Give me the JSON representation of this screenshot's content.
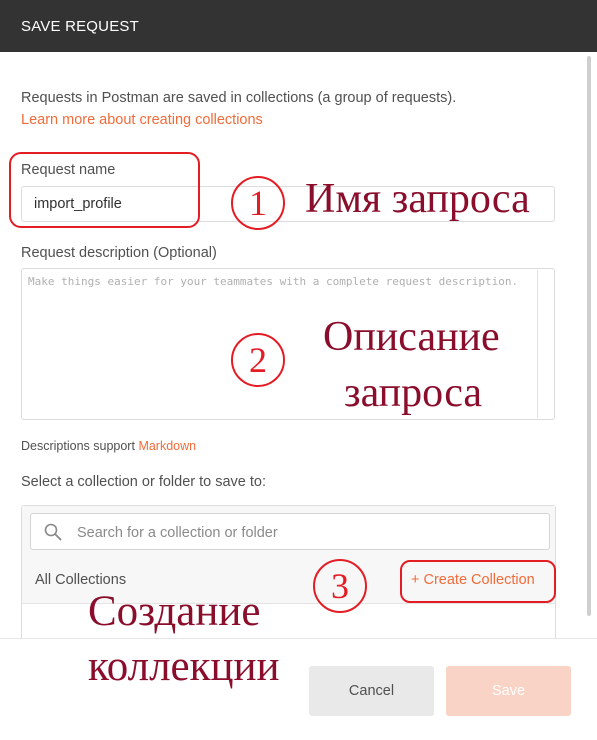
{
  "dialog": {
    "title": "SAVE REQUEST",
    "intro_text": "Requests in Postman are saved in collections (a group of requests).",
    "learn_more_link": "Learn more about creating collections",
    "request_name_label": "Request name",
    "request_name_value": "import_profile",
    "request_description_label": "Request description (Optional)",
    "request_description_placeholder": "Make things easier for your teammates with a complete request description.",
    "descriptions_support_text": "Descriptions support",
    "markdown_link": "Markdown",
    "select_collection_label": "Select a collection or folder to save to:",
    "search_placeholder": "Search for a collection or folder",
    "all_collections_label": "All Collections",
    "create_collection_link": "+ Create Collection",
    "cancel_button": "Cancel",
    "save_button": "Save"
  },
  "annotations": {
    "step1_number": "1",
    "step1_text": "Имя запроса",
    "step2_number": "2",
    "step2_line1": "Описание",
    "step2_line2": "запроса",
    "step3_number": "3",
    "step3_line1": "Создание",
    "step3_line2": "коллекции"
  },
  "colors": {
    "header_bg": "#333333",
    "accent": "#f26b3a",
    "annotation_red": "#e41c24",
    "annotation_text": "#8a0e2c"
  }
}
